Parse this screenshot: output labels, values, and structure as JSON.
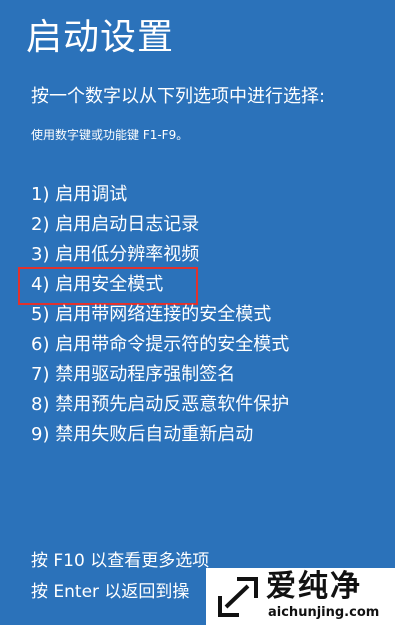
{
  "title": "启动设置",
  "prompt": "按一个数字以从下列选项中进行选择:",
  "hint": "使用数字键或功能键 F1-F9。",
  "options": [
    {
      "label": "1) 启用调试"
    },
    {
      "label": "2) 启用启动日志记录"
    },
    {
      "label": "3) 启用低分辨率视频"
    },
    {
      "label": "4) 启用安全模式"
    },
    {
      "label": "5) 启用带网络连接的安全模式"
    },
    {
      "label": "6) 启用带命令提示符的安全模式"
    },
    {
      "label": "7) 禁用驱动程序强制签名"
    },
    {
      "label": "8) 禁用预先启动反恶意软件保护"
    },
    {
      "label": "9) 禁用失败后自动重新启动"
    }
  ],
  "highlighted_option_index": 3,
  "footer": {
    "line1": "按 F10 以查看更多选项",
    "line2": "按 Enter 以返回到操"
  },
  "watermark": {
    "brand": "爱纯净",
    "domain": "aichunjing.com",
    "logo_icon": "window-corner-icon"
  },
  "colors": {
    "background": "#2b72ba",
    "text": "#ffffff",
    "highlight_border": "#e0322e"
  }
}
